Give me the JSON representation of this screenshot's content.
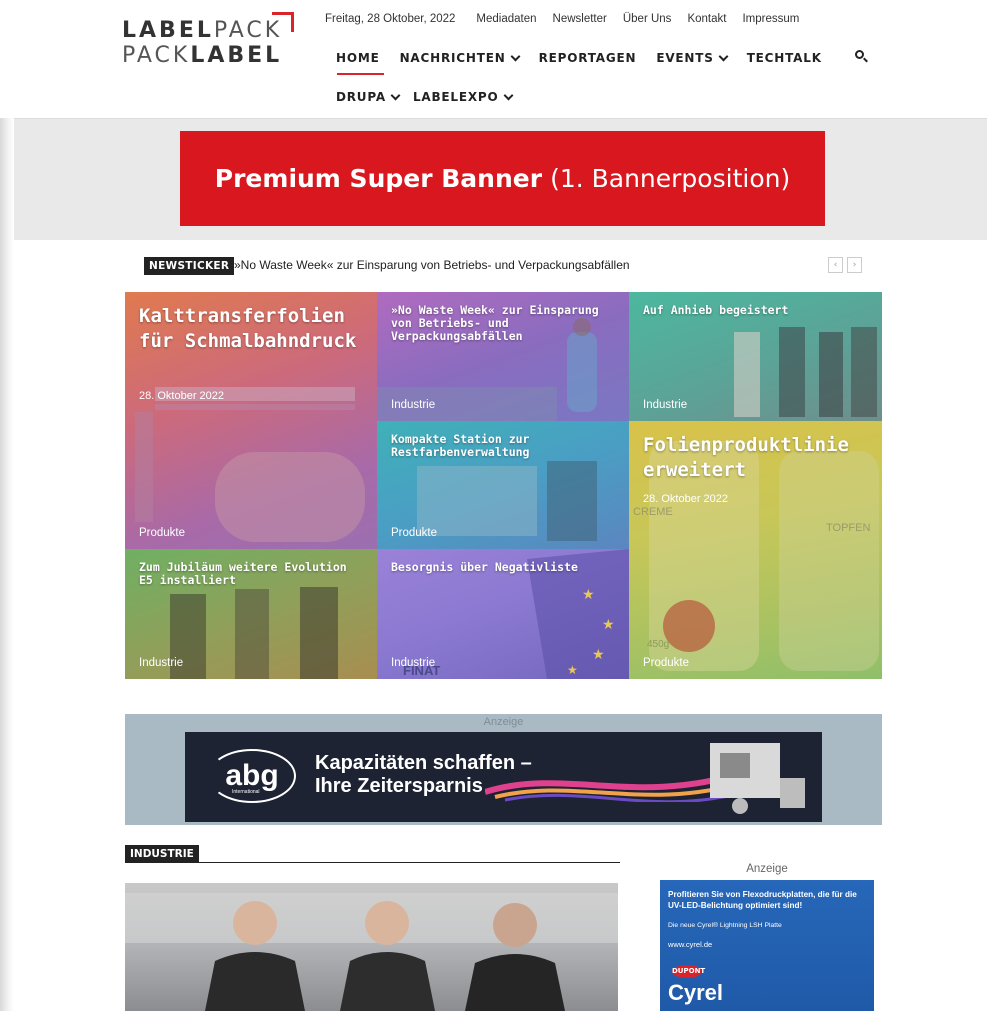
{
  "logo": {
    "line1_bold": "LABEL",
    "line1_rest": "PACK",
    "line2_rest": "PACK",
    "line2_bold": "LABEL"
  },
  "topnav": {
    "date": "Freitag, 28 Oktober, 2022",
    "items": [
      "Mediadaten",
      "Newsletter",
      "Über Uns",
      "Kontakt",
      "Impressum"
    ]
  },
  "mainnav": {
    "items": [
      "HOME",
      "NACHRICHTEN",
      "REPORTAGEN",
      "EVENTS",
      "TECHTALK"
    ],
    "items2": [
      "DRUPA",
      "LABELEXPO"
    ]
  },
  "premium_banner": {
    "bold": "Premium Super Banner",
    "rest": "(1. Bannerposition)"
  },
  "newsticker": {
    "label": "NEWSTICKER",
    "text": "»No Waste Week« zur Einsparung von Betriebs- und Verpackungsabfällen",
    "prev": "‹",
    "next": "›"
  },
  "tiles": [
    {
      "title": "Kalttransferfolien für Schmalbahndruck",
      "date": "28. Oktober 2022",
      "category": "Produkte"
    },
    {
      "title": "»No Waste Week« zur Einsparung von Betriebs- und Verpackungsabfällen",
      "category": "Industrie"
    },
    {
      "title": "Auf Anhieb begeistert",
      "category": "Industrie"
    },
    {
      "title": "Kompakte Station zur Restfarbenverwaltung",
      "category": "Produkte"
    },
    {
      "title": "Folienproduktlinie erweitert",
      "date": "28. Oktober 2022",
      "category": "Produkte",
      "extra1": "CREME",
      "extra2": "TOPFEN",
      "extra3": "450g"
    },
    {
      "title": "Zum Jubiläum weitere Evolution E5 installiert",
      "category": "Industrie"
    },
    {
      "title": "Besorgnis über Negativliste",
      "category": "Industrie",
      "extra1": "FINAT"
    }
  ],
  "ad": {
    "label": "Anzeige",
    "logo": "abg",
    "logo_sub": "International",
    "headline1": "Kapazitäten schaffen –",
    "headline2": "Ihre Zeitersparnis"
  },
  "section": {
    "label": "INDUSTRIE"
  },
  "side_ad": {
    "label": "Anzeige",
    "line1": "Profitieren Sie von Flexodruckplatten, die für die UV-LED-Belichtung optimiert sind!",
    "line2": "Die neue Cyrel® Lightning LSH Platte",
    "line3": "www.cyrel.de",
    "brand_oval": "DUPONT",
    "brand": "Cyrel"
  },
  "colors": {
    "accent": "#d8242a",
    "banner": "#d8171e",
    "ad_band": "#a9bac5"
  }
}
